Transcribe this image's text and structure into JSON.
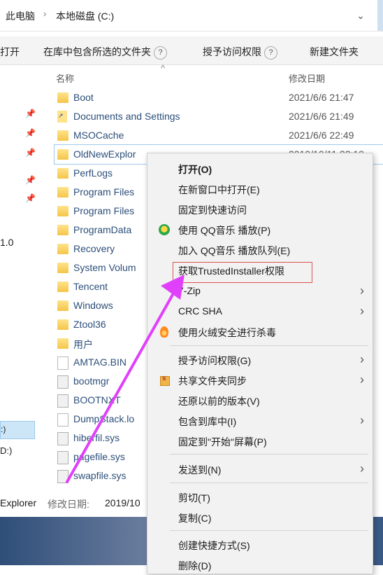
{
  "breadcrumb": {
    "items": [
      "此电脑",
      "本地磁盘 (C:)"
    ],
    "separator": "›"
  },
  "toolbar": {
    "open": "打开",
    "include_in_library": "在库中包含所选的文件夹",
    "grant_access": "授予访问权限",
    "new_folder": "新建文件夹",
    "help_glyph": "?"
  },
  "columns": {
    "name": "名称",
    "modified": "修改日期"
  },
  "nav": {
    "label_version": "1.0",
    "drive_c": ":)",
    "drive_d": "D:)"
  },
  "files": [
    {
      "name": "Boot",
      "date": "2021/6/6 21:47",
      "type": "folder"
    },
    {
      "name": "Documents and Settings",
      "date": "2021/6/6 21:49",
      "type": "shortcut"
    },
    {
      "name": "MSOCache",
      "date": "2021/6/6 22:49",
      "type": "folder"
    },
    {
      "name": "OldNewExplor",
      "date": "2019/10/11 22:18",
      "type": "folder"
    },
    {
      "name": "PerfLogs",
      "date": "",
      "type": "folder"
    },
    {
      "name": "Program Files",
      "date": "",
      "type": "folder"
    },
    {
      "name": "Program Files",
      "date": "",
      "type": "folder"
    },
    {
      "name": "ProgramData",
      "date": "",
      "type": "folder"
    },
    {
      "name": "Recovery",
      "date": "",
      "type": "folder"
    },
    {
      "name": "System Volum",
      "date": "",
      "type": "folder"
    },
    {
      "name": "Tencent",
      "date": "",
      "type": "folder"
    },
    {
      "name": "Windows",
      "date": "",
      "type": "folder"
    },
    {
      "name": "Ztool36",
      "date": "",
      "type": "folder"
    },
    {
      "name": "用户",
      "date": "",
      "type": "folder"
    },
    {
      "name": "AMTAG.BIN",
      "date": "",
      "type": "file"
    },
    {
      "name": "bootmgr",
      "date": "",
      "type": "sys"
    },
    {
      "name": "BOOTNXT",
      "date": "",
      "type": "sys"
    },
    {
      "name": "DumpStack.lo",
      "date": "",
      "type": "file"
    },
    {
      "name": "hiberfil.sys",
      "date": "",
      "type": "sys"
    },
    {
      "name": "pagefile.sys",
      "date": "",
      "type": "sys"
    },
    {
      "name": "swapfile.sys",
      "date": "",
      "type": "sys"
    }
  ],
  "status": {
    "name": "Explorer",
    "modified_label": "修改日期:",
    "modified_value": "2019/10"
  },
  "context_menu": {
    "open": "打开(O)",
    "open_new_window": "在新窗口中打开(E)",
    "pin_quick_access": "固定到快速访问",
    "qq_play": "使用 QQ音乐 播放(P)",
    "qq_queue": "加入 QQ音乐 播放队列(E)",
    "trusted_installer": "获取TrustedInstaller权限",
    "zip": "7-Zip",
    "crc": "CRC SHA",
    "huorong": "使用火绒安全进行杀毒",
    "grant_access": "授予访问权限(G)",
    "share_sync": "共享文件夹同步",
    "restore_versions": "还原以前的版本(V)",
    "include_library": "包含到库中(I)",
    "pin_start": "固定到\"开始\"屏幕(P)",
    "send_to": "发送到(N)",
    "cut": "剪切(T)",
    "copy": "复制(C)",
    "create_shortcut": "创建快捷方式(S)",
    "delete": "删除(D)",
    "submenu_glyph": "›"
  },
  "colors": {
    "highlight_box": "#d9534f",
    "arrow": "#e040fb",
    "selection": "#cde6f7"
  }
}
